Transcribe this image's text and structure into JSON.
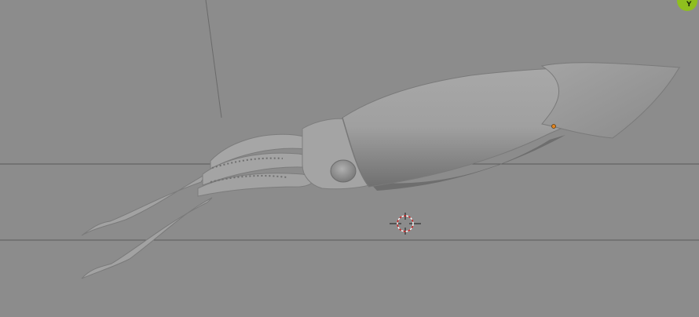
{
  "viewport": {
    "background_color": "#8c8c8c",
    "grid_line_color": "#5a5a5a",
    "model_color": "#9c9c9c",
    "origin_point_color": "#e38420",
    "view_axis_gizmo": {
      "label": "Y",
      "color": "#8fbf1e",
      "icon": "axis-y-icon"
    },
    "objects": [
      {
        "name": "squid-mesh",
        "icon": "squid-icon"
      },
      {
        "name": "3d-cursor",
        "icon": "crosshair-icon"
      }
    ]
  }
}
